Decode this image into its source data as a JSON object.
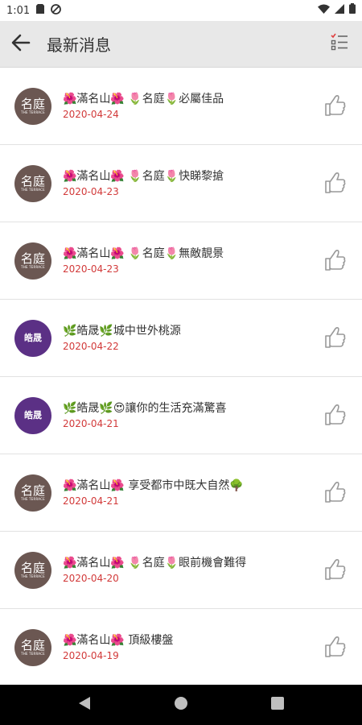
{
  "status": {
    "time": "1:01"
  },
  "header": {
    "title": "最新消息"
  },
  "avatars": {
    "mingting": {
      "big": "名庭",
      "small": "THE TERRACE"
    },
    "haoshi": {
      "mono": "皓晟"
    }
  },
  "messages": [
    {
      "title": "🌺滿名山🌺 🌷名庭🌷必屬佳品",
      "date": "2020-04-24",
      "avatar": "mingting"
    },
    {
      "title": "🌺滿名山🌺 🌷名庭🌷快睇黎搶",
      "date": "2020-04-23",
      "avatar": "mingting"
    },
    {
      "title": "🌺滿名山🌺 🌷名庭🌷無敵靚景",
      "date": "2020-04-23",
      "avatar": "mingting"
    },
    {
      "title": "🌿皓晟🌿城中世外桃源",
      "date": "2020-04-22",
      "avatar": "haoshi"
    },
    {
      "title": "🌿皓晟🌿😍讓你的生活充滿驚喜",
      "date": "2020-04-21",
      "avatar": "haoshi"
    },
    {
      "title": "🌺滿名山🌺 享受都市中既大自然🌳",
      "date": "2020-04-21",
      "avatar": "mingting"
    },
    {
      "title": "🌺滿名山🌺 🌷名庭🌷眼前機會難得",
      "date": "2020-04-20",
      "avatar": "mingting"
    },
    {
      "title": "🌺滿名山🌺 頂級樓盤",
      "date": "2020-04-19",
      "avatar": "mingting"
    }
  ],
  "colors": {
    "date": "#d23a3a",
    "appbar": "#e8e8e8",
    "avatar_brown": "#6b5752",
    "avatar_purple": "#5b3085"
  },
  "icons": {
    "back": "arrow-left-icon",
    "menu": "checklist-icon",
    "like": "thumbs-up-icon"
  }
}
